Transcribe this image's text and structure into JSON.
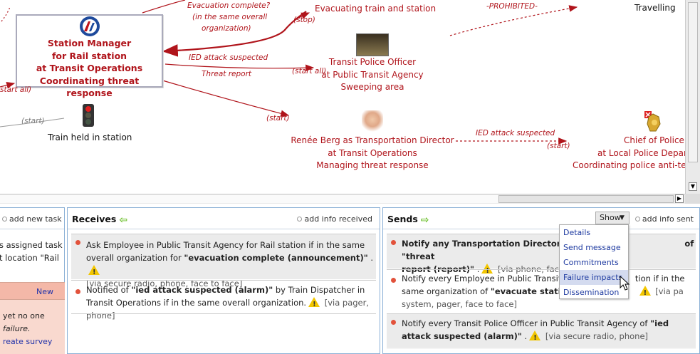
{
  "diagram": {
    "station_manager": {
      "line1": "Station Manager",
      "line2": "for Rail station",
      "line3": "at Transit Operations",
      "line4": "Coordinating threat response"
    },
    "flow_labels": {
      "evac_complete_1": "Evacuation complete?",
      "evac_complete_2": "(in the same overall",
      "evac_complete_3": "organization)",
      "stop": "(stop)",
      "prohibited": "-PROHIBITED-",
      "ied_suspected": "IED attack suspected",
      "threat_report": "Threat report",
      "start_all_right": "(start all)",
      "start_all_left": "start all)",
      "start_grey": "(start)",
      "start_renee": "(start)",
      "ied_suspected_2": "IED attack suspected",
      "start_chief": "(start)"
    },
    "evacuating_train": "Evacuating train and station",
    "travelling": "Travelling",
    "transit_police": {
      "line1": "Transit Police Officer",
      "line2": "at Public Transit Agency",
      "line3": "Sweeping area"
    },
    "train_held": "Train held in station",
    "renee": {
      "line1": "Renée Berg as Transportation Director",
      "line2": "at Transit Operations",
      "line3": "Managing threat response"
    },
    "chief": {
      "line1": "Chief of Police",
      "line2": "at Local Police Depar",
      "line3": "Coordinating police anti-terr"
    }
  },
  "left_panel": {
    "add_new_task": "add new task",
    "line1": "s assigned task",
    "line2": "t location \"Rail",
    "new_badge": "New",
    "line3": "yet no one",
    "line4": "failure.",
    "create_survey": "reate survey"
  },
  "receives": {
    "title": "Receives",
    "add_info": "add info received",
    "items": [
      {
        "pre": "Ask Employee in Public Transit Agency for Rail station if in the same overall organization for ",
        "bold": "\"evacuation complete (announcement)\"",
        "post": " .",
        "via": "[via secure radio, phone, face to face]"
      },
      {
        "pre": "Notified of ",
        "bold": "\"ied attack suspected (alarm)\"",
        "post": " by Train Dispatcher in Transit Operations if in the same overall organization.",
        "via": "[via pager, phone]"
      }
    ]
  },
  "sends": {
    "title": "Sends",
    "show": "Show",
    "add_info": "add info sent",
    "items": [
      {
        "bold1": "Notify any Transportation Director in T",
        "bold2": "of \"threat",
        "bold3": "report (report)\"",
        "post": " .",
        "via": "[via phone, face to"
      },
      {
        "pre1": "Notify every Employee in Public Transit A",
        "pre2": "tion if in the",
        "pre3": "same organization of ",
        "bold": "\"evacuate station",
        "via1": "[via pa",
        "via2": "system, pager, face to face]"
      },
      {
        "pre": "Notify every Transit Police Officer in Public Transit Agency of ",
        "bold": "\"ied attack suspected (alarm)\"",
        "post": " .",
        "via": "[via secure radio, phone]"
      }
    ],
    "menu": [
      "Details",
      "Send message",
      "Commitments",
      "Failure impacts",
      "Dissemination"
    ]
  },
  "colors": {
    "flow_red": "#b0141b",
    "panel_border": "#8ab0d6",
    "menu_hover": "#d4dbef",
    "bullet": "#e2523b"
  }
}
